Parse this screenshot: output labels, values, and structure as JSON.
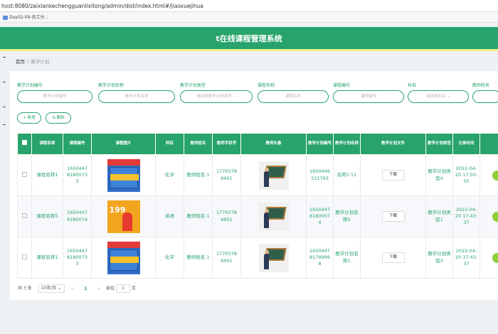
{
  "browser": {
    "url": "host:8080/zaixiankechengguanlixitong/admin/dist/index.html#/jiaoxuejihua",
    "bookmark": "Day02-09-员工分..."
  },
  "app": {
    "title": "t在线课程管理系统"
  },
  "breadcrumb": {
    "home": "首页",
    "sep": "/",
    "current": "教学计划"
  },
  "search": {
    "fields": [
      {
        "label": "教学计划编号",
        "placeholder": "教学计划编号"
      },
      {
        "label": "教学计划名称",
        "placeholder": "教学计划名称"
      },
      {
        "label": "教学计划类型",
        "placeholder": "请选择教学计划类型"
      },
      {
        "label": "课程名称",
        "placeholder": "课程名称"
      },
      {
        "label": "课程编号",
        "placeholder": "课程编号"
      },
      {
        "label": "科目",
        "placeholder": "请选择科目"
      },
      {
        "label": "教师姓名",
        "placeholder": ""
      }
    ]
  },
  "actions": {
    "add": "+ 新增",
    "delete": "删除"
  },
  "table": {
    "headers": [
      "课程名称",
      "课程编号",
      "课程图片",
      "科目",
      "教师姓名",
      "教师手机号",
      "教师头像",
      "教学计划编号",
      "教学计划名称",
      "教学计划文件",
      "教学计划类型",
      "记录时间"
    ],
    "rows": [
      {
        "course_name": "课程名称1",
        "course_no": "1650447 8180073 3",
        "image": "book-blue",
        "subject": "化学",
        "teacher": "教师姓名 1",
        "phone": "1770378 6901",
        "plan_no": "1650446 231793",
        "plan_name": "名称1'11",
        "file": "下载",
        "plan_type": "教学计划类型4",
        "time": "2022-04-20 17:50:55"
      },
      {
        "course_name": "课程名称5",
        "course_no": "1650447 8180074",
        "image": "book-orange",
        "subject": "英语",
        "teacher": "教师姓名 1",
        "phone": "1770378 6901",
        "plan_no": "1650447 8180007 4",
        "plan_name": "教学计划名称5",
        "file": "下载",
        "plan_type": "教学计划类型1",
        "time": "2022-04-20 17:43:37"
      },
      {
        "course_name": "课程名称1",
        "course_no": "1650447 8180073 3",
        "image": "book-blue",
        "subject": "化学",
        "teacher": "教师姓名 1",
        "phone": "1770378 6901",
        "plan_no": "1650447 8179999 8",
        "plan_name": "教学计划名称1",
        "file": "下载",
        "plan_type": "教学计划类型3",
        "time": "2022-04-20 17:43:37"
      }
    ]
  },
  "pager": {
    "total": "共 3 条",
    "size": "10条/页",
    "prev": "<",
    "page": "1",
    "next": ">",
    "goto": "前往",
    "goto_val": "1",
    "unit": "页"
  },
  "colors": {
    "accent": "#27a36b",
    "header_border": "#f5f08a"
  }
}
